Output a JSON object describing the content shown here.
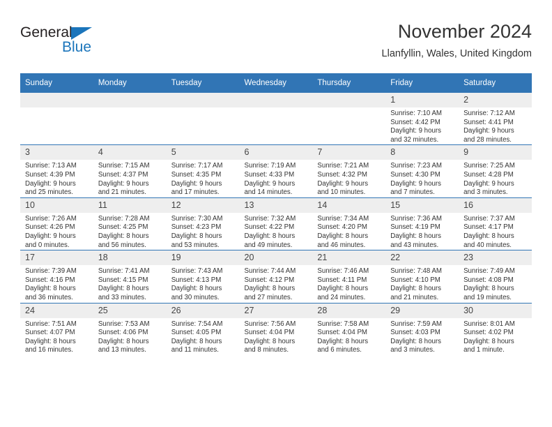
{
  "brand": {
    "name_part1": "General",
    "name_part2": "Blue",
    "color_primary": "#1b75bb",
    "color_text": "#231f20"
  },
  "header": {
    "title": "November 2024",
    "location": "Llanfyllin, Wales, United Kingdom"
  },
  "theme": {
    "header_bg": "#3175b5",
    "daynum_bg": "#eeeeee",
    "text": "#333333"
  },
  "weekdays": [
    "Sunday",
    "Monday",
    "Tuesday",
    "Wednesday",
    "Thursday",
    "Friday",
    "Saturday"
  ],
  "weeks": [
    [
      {
        "day": "",
        "sunrise": "",
        "sunset": "",
        "daylight1": "",
        "daylight2": "",
        "empty": true
      },
      {
        "day": "",
        "sunrise": "",
        "sunset": "",
        "daylight1": "",
        "daylight2": "",
        "empty": true
      },
      {
        "day": "",
        "sunrise": "",
        "sunset": "",
        "daylight1": "",
        "daylight2": "",
        "empty": true
      },
      {
        "day": "",
        "sunrise": "",
        "sunset": "",
        "daylight1": "",
        "daylight2": "",
        "empty": true
      },
      {
        "day": "",
        "sunrise": "",
        "sunset": "",
        "daylight1": "",
        "daylight2": "",
        "empty": true
      },
      {
        "day": "1",
        "sunrise": "Sunrise: 7:10 AM",
        "sunset": "Sunset: 4:42 PM",
        "daylight1": "Daylight: 9 hours",
        "daylight2": "and 32 minutes."
      },
      {
        "day": "2",
        "sunrise": "Sunrise: 7:12 AM",
        "sunset": "Sunset: 4:41 PM",
        "daylight1": "Daylight: 9 hours",
        "daylight2": "and 28 minutes."
      }
    ],
    [
      {
        "day": "3",
        "sunrise": "Sunrise: 7:13 AM",
        "sunset": "Sunset: 4:39 PM",
        "daylight1": "Daylight: 9 hours",
        "daylight2": "and 25 minutes."
      },
      {
        "day": "4",
        "sunrise": "Sunrise: 7:15 AM",
        "sunset": "Sunset: 4:37 PM",
        "daylight1": "Daylight: 9 hours",
        "daylight2": "and 21 minutes."
      },
      {
        "day": "5",
        "sunrise": "Sunrise: 7:17 AM",
        "sunset": "Sunset: 4:35 PM",
        "daylight1": "Daylight: 9 hours",
        "daylight2": "and 17 minutes."
      },
      {
        "day": "6",
        "sunrise": "Sunrise: 7:19 AM",
        "sunset": "Sunset: 4:33 PM",
        "daylight1": "Daylight: 9 hours",
        "daylight2": "and 14 minutes."
      },
      {
        "day": "7",
        "sunrise": "Sunrise: 7:21 AM",
        "sunset": "Sunset: 4:32 PM",
        "daylight1": "Daylight: 9 hours",
        "daylight2": "and 10 minutes."
      },
      {
        "day": "8",
        "sunrise": "Sunrise: 7:23 AM",
        "sunset": "Sunset: 4:30 PM",
        "daylight1": "Daylight: 9 hours",
        "daylight2": "and 7 minutes."
      },
      {
        "day": "9",
        "sunrise": "Sunrise: 7:25 AM",
        "sunset": "Sunset: 4:28 PM",
        "daylight1": "Daylight: 9 hours",
        "daylight2": "and 3 minutes."
      }
    ],
    [
      {
        "day": "10",
        "sunrise": "Sunrise: 7:26 AM",
        "sunset": "Sunset: 4:26 PM",
        "daylight1": "Daylight: 9 hours",
        "daylight2": "and 0 minutes."
      },
      {
        "day": "11",
        "sunrise": "Sunrise: 7:28 AM",
        "sunset": "Sunset: 4:25 PM",
        "daylight1": "Daylight: 8 hours",
        "daylight2": "and 56 minutes."
      },
      {
        "day": "12",
        "sunrise": "Sunrise: 7:30 AM",
        "sunset": "Sunset: 4:23 PM",
        "daylight1": "Daylight: 8 hours",
        "daylight2": "and 53 minutes."
      },
      {
        "day": "13",
        "sunrise": "Sunrise: 7:32 AM",
        "sunset": "Sunset: 4:22 PM",
        "daylight1": "Daylight: 8 hours",
        "daylight2": "and 49 minutes."
      },
      {
        "day": "14",
        "sunrise": "Sunrise: 7:34 AM",
        "sunset": "Sunset: 4:20 PM",
        "daylight1": "Daylight: 8 hours",
        "daylight2": "and 46 minutes."
      },
      {
        "day": "15",
        "sunrise": "Sunrise: 7:36 AM",
        "sunset": "Sunset: 4:19 PM",
        "daylight1": "Daylight: 8 hours",
        "daylight2": "and 43 minutes."
      },
      {
        "day": "16",
        "sunrise": "Sunrise: 7:37 AM",
        "sunset": "Sunset: 4:17 PM",
        "daylight1": "Daylight: 8 hours",
        "daylight2": "and 40 minutes."
      }
    ],
    [
      {
        "day": "17",
        "sunrise": "Sunrise: 7:39 AM",
        "sunset": "Sunset: 4:16 PM",
        "daylight1": "Daylight: 8 hours",
        "daylight2": "and 36 minutes."
      },
      {
        "day": "18",
        "sunrise": "Sunrise: 7:41 AM",
        "sunset": "Sunset: 4:15 PM",
        "daylight1": "Daylight: 8 hours",
        "daylight2": "and 33 minutes."
      },
      {
        "day": "19",
        "sunrise": "Sunrise: 7:43 AM",
        "sunset": "Sunset: 4:13 PM",
        "daylight1": "Daylight: 8 hours",
        "daylight2": "and 30 minutes."
      },
      {
        "day": "20",
        "sunrise": "Sunrise: 7:44 AM",
        "sunset": "Sunset: 4:12 PM",
        "daylight1": "Daylight: 8 hours",
        "daylight2": "and 27 minutes."
      },
      {
        "day": "21",
        "sunrise": "Sunrise: 7:46 AM",
        "sunset": "Sunset: 4:11 PM",
        "daylight1": "Daylight: 8 hours",
        "daylight2": "and 24 minutes."
      },
      {
        "day": "22",
        "sunrise": "Sunrise: 7:48 AM",
        "sunset": "Sunset: 4:10 PM",
        "daylight1": "Daylight: 8 hours",
        "daylight2": "and 21 minutes."
      },
      {
        "day": "23",
        "sunrise": "Sunrise: 7:49 AM",
        "sunset": "Sunset: 4:08 PM",
        "daylight1": "Daylight: 8 hours",
        "daylight2": "and 19 minutes."
      }
    ],
    [
      {
        "day": "24",
        "sunrise": "Sunrise: 7:51 AM",
        "sunset": "Sunset: 4:07 PM",
        "daylight1": "Daylight: 8 hours",
        "daylight2": "and 16 minutes."
      },
      {
        "day": "25",
        "sunrise": "Sunrise: 7:53 AM",
        "sunset": "Sunset: 4:06 PM",
        "daylight1": "Daylight: 8 hours",
        "daylight2": "and 13 minutes."
      },
      {
        "day": "26",
        "sunrise": "Sunrise: 7:54 AM",
        "sunset": "Sunset: 4:05 PM",
        "daylight1": "Daylight: 8 hours",
        "daylight2": "and 11 minutes."
      },
      {
        "day": "27",
        "sunrise": "Sunrise: 7:56 AM",
        "sunset": "Sunset: 4:04 PM",
        "daylight1": "Daylight: 8 hours",
        "daylight2": "and 8 minutes."
      },
      {
        "day": "28",
        "sunrise": "Sunrise: 7:58 AM",
        "sunset": "Sunset: 4:04 PM",
        "daylight1": "Daylight: 8 hours",
        "daylight2": "and 6 minutes."
      },
      {
        "day": "29",
        "sunrise": "Sunrise: 7:59 AM",
        "sunset": "Sunset: 4:03 PM",
        "daylight1": "Daylight: 8 hours",
        "daylight2": "and 3 minutes."
      },
      {
        "day": "30",
        "sunrise": "Sunrise: 8:01 AM",
        "sunset": "Sunset: 4:02 PM",
        "daylight1": "Daylight: 8 hours",
        "daylight2": "and 1 minute."
      }
    ]
  ]
}
